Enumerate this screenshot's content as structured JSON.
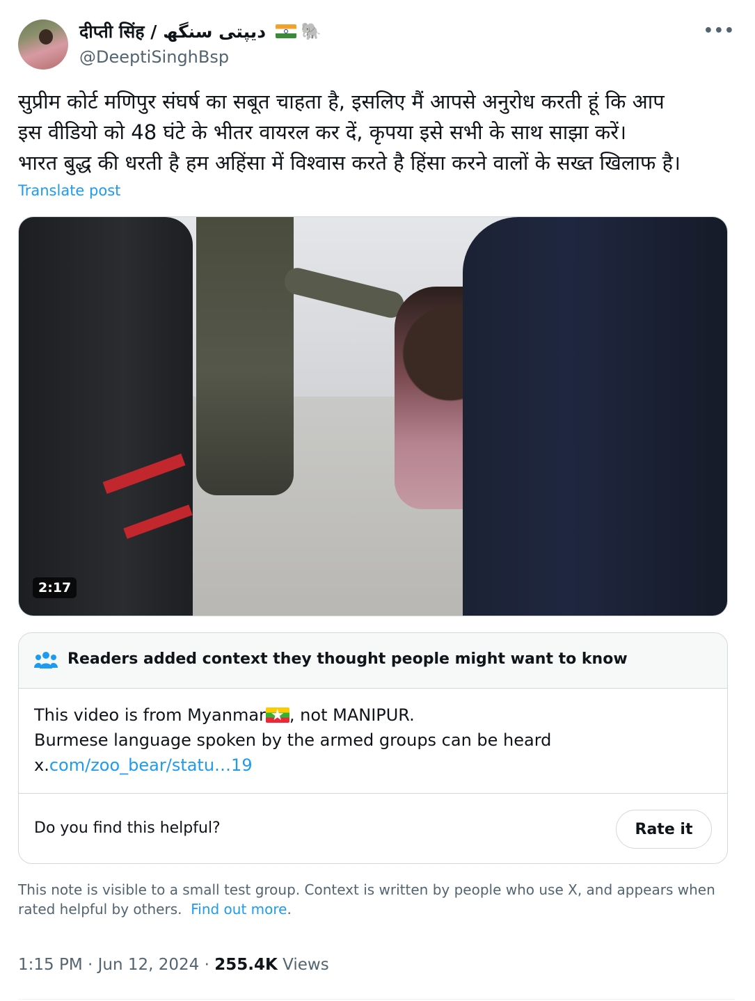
{
  "author": {
    "name": "दीप्ती सिंह / دیپتی سنگھ",
    "handle": "@DeeptiSinghBsp",
    "elephant_emoji": "🐘"
  },
  "tweet": {
    "text": "सुप्रीम कोर्ट मणिपुर संघर्ष का सबूत चाहता है, इसलिए मैं आपसे अनुरोध करती हूं कि आप\nइस वीडियो को 48 घंटे के भीतर वायरल कर दें, कृपया इसे सभी के साथ साझा करें।\nभारत बुद्ध की धरती है हम अहिंसा में विश्वास करते है हिंसा करने वालों के सख्त खिलाफ है।",
    "translate_label": "Translate post"
  },
  "video": {
    "duration": "2:17"
  },
  "community_note": {
    "header": "Readers added context they thought people might want to know",
    "line1_a": "This video is from Myanmar",
    "line1_b": ", not MANIPUR.",
    "line2": "Burmese language spoken by the armed groups can be heard",
    "link_prefix": "x.",
    "link_text": "com/zoo_bear/statu…19",
    "helpful_question": "Do you find this helpful?",
    "rate_button": "Rate it"
  },
  "disclaimer": {
    "text": "This note is visible to a small test group. Context is written by people who use X, and appears when rated helpful by others.",
    "link": "Find out more",
    "end": "."
  },
  "meta": {
    "time": "1:15 PM",
    "sep1": " · ",
    "date": "Jun 12, 2024",
    "sep2": " · ",
    "views_count": "255.4K",
    "views_label": " Views"
  },
  "colors": {
    "accent": "#1d9bf0",
    "text": "#0f1419",
    "muted": "#536471",
    "border": "#cfd9de"
  }
}
